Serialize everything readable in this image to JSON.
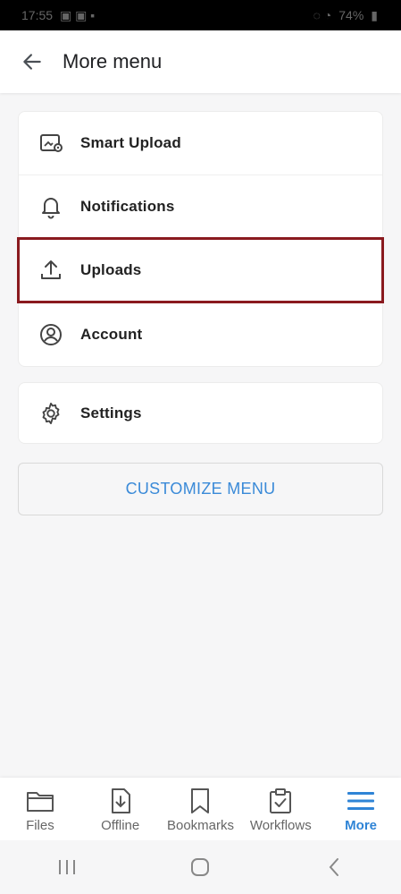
{
  "status_bar": {
    "time": "17:55",
    "battery": "74%"
  },
  "header": {
    "title": "More menu"
  },
  "menu_groups": [
    {
      "items": [
        {
          "label": "Smart Upload",
          "icon": "smart-upload-icon"
        },
        {
          "label": "Notifications",
          "icon": "bell-icon"
        },
        {
          "label": "Uploads",
          "icon": "upload-icon",
          "highlighted": true
        },
        {
          "label": "Account",
          "icon": "account-icon"
        }
      ]
    },
    {
      "items": [
        {
          "label": "Settings",
          "icon": "gear-icon"
        }
      ]
    }
  ],
  "customize": {
    "label": "CUSTOMIZE MENU"
  },
  "bottom_nav": {
    "items": [
      {
        "label": "Files",
        "icon": "folder-icon"
      },
      {
        "label": "Offline",
        "icon": "offline-download-icon"
      },
      {
        "label": "Bookmarks",
        "icon": "bookmark-icon"
      },
      {
        "label": "Workflows",
        "icon": "clipboard-check-icon"
      },
      {
        "label": "More",
        "icon": "hamburger-menu-icon",
        "active": true
      }
    ]
  },
  "colors": {
    "accent": "#2f84d6",
    "highlight": "#8a1a1f"
  }
}
